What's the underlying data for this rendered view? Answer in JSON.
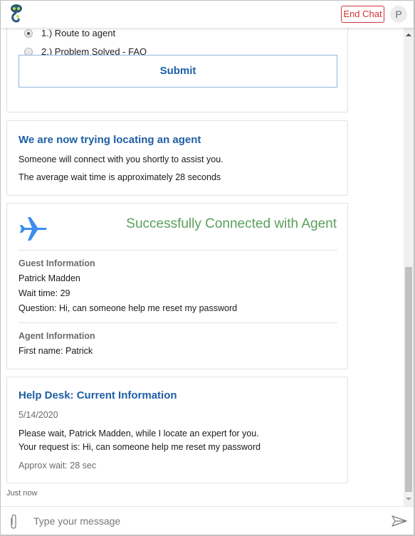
{
  "header": {
    "logo_icon": "robot-bot-icon",
    "end_chat_label": "End Chat",
    "avatar_initial": "P"
  },
  "cards": {
    "options": {
      "items": [
        {
          "label": "1.) Route to agent",
          "checked": true
        },
        {
          "label": "2.) Problem Solved - FAQ",
          "checked": false
        }
      ],
      "submit_label": "Submit"
    },
    "locating": {
      "title": "We are now trying locating an agent",
      "line1": "Someone will connect with you shortly to assist you.",
      "line2": "The average wait time is approximately 28 seconds"
    },
    "connected": {
      "icon": "airplane-icon",
      "title": "Successfully Connected with Agent",
      "guest_heading": "Guest Information",
      "guest_name": "Patrick Madden",
      "wait_time": "Wait time: 29",
      "question": "Question: Hi, can someone help me reset my password",
      "agent_heading": "Agent Information",
      "agent_first_name": "First name: Patrick"
    },
    "helpdesk": {
      "title": "Help Desk: Current Information",
      "date": "5/14/2020",
      "line1": "Please wait, Patrick Madden, while I locate an expert for you.",
      "line2": "Your request is: Hi, can someone help me reset my password",
      "approx_wait": "Approx wait: 28 sec"
    }
  },
  "timestamp": "Just now",
  "composer": {
    "placeholder": "Type your message",
    "value": ""
  },
  "colors": {
    "accent_blue": "#1e5fa5",
    "success_green": "#5aa05c",
    "end_chat_red": "#d13438",
    "airplane_blue": "#3a8ef0"
  }
}
